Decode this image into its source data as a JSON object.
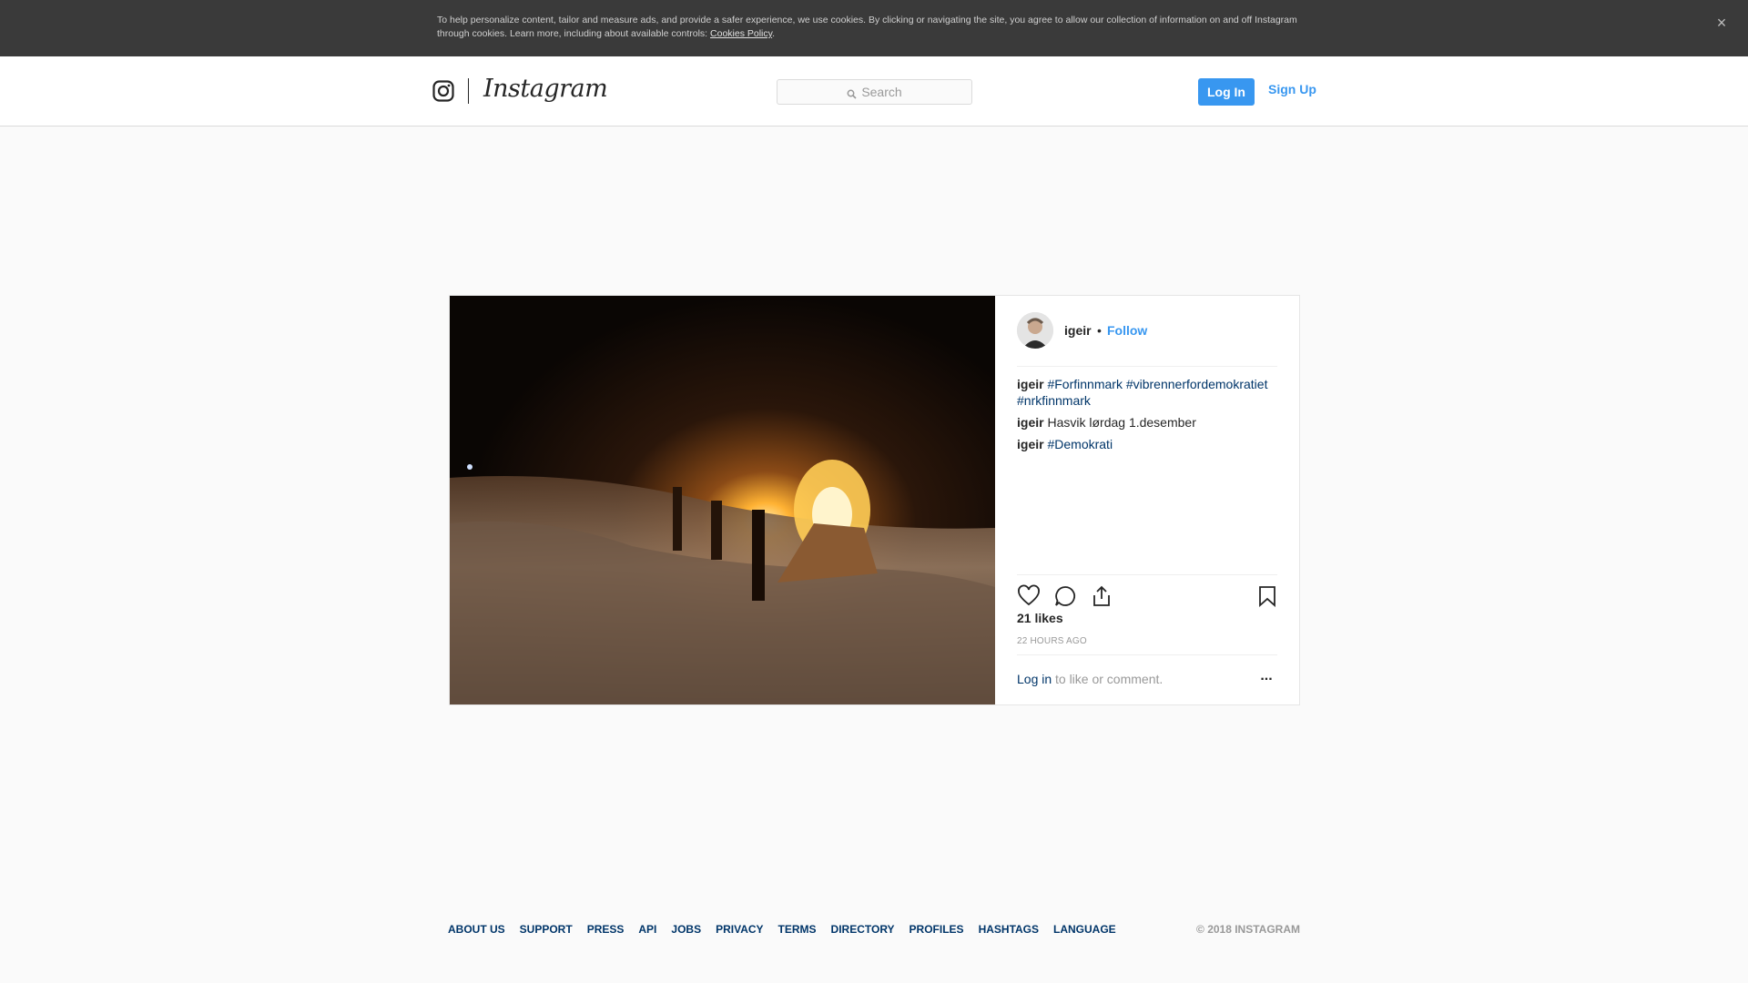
{
  "cookie_banner": {
    "text": "To help personalize content, tailor and measure ads, and provide a safer experience, we use cookies. By clicking or navigating the site, you agree to allow our collection of information on and off Instagram through cookies. Learn more, including about available controls: ",
    "link_label": "Cookies Policy",
    "suffix": ".",
    "close_icon": "×"
  },
  "header": {
    "brand_name": "Instagram",
    "search_placeholder": "Search",
    "login_label": "Log In",
    "signup_label": "Sign Up"
  },
  "post": {
    "username": "igeir",
    "separator": "•",
    "follow_label": "Follow",
    "comments": [
      {
        "user": "igeir",
        "tags": [
          "#Forfinnmark",
          "#vibrennerfordemokratiet",
          "#nrkfinnmark"
        ],
        "text": ""
      },
      {
        "user": "igeir",
        "text": "Hasvik lørdag 1.desember"
      },
      {
        "user": "igeir",
        "prefix": "",
        "tags": [
          "#Demokrati"
        ]
      }
    ],
    "likes": "21 likes",
    "timestamp": "22 HOURS AGO",
    "login_link": "Log in",
    "login_suffix": " to like or comment.",
    "more_label": "..."
  },
  "footer": {
    "links": [
      "ABOUT US",
      "SUPPORT",
      "PRESS",
      "API",
      "JOBS",
      "PRIVACY",
      "TERMS",
      "DIRECTORY",
      "PROFILES",
      "HASHTAGS",
      "LANGUAGE"
    ],
    "copyright": "© 2018 INSTAGRAM"
  },
  "colors": {
    "accent": "#3897f0",
    "link_dark": "#003569",
    "banner_bg": "#3a3a3a"
  },
  "icons": {
    "brand": "instagram-camera-icon",
    "search": "search-icon",
    "like": "heart-icon",
    "comment": "comment-bubble-icon",
    "share": "share-icon",
    "save": "bookmark-icon",
    "close": "close-icon"
  }
}
